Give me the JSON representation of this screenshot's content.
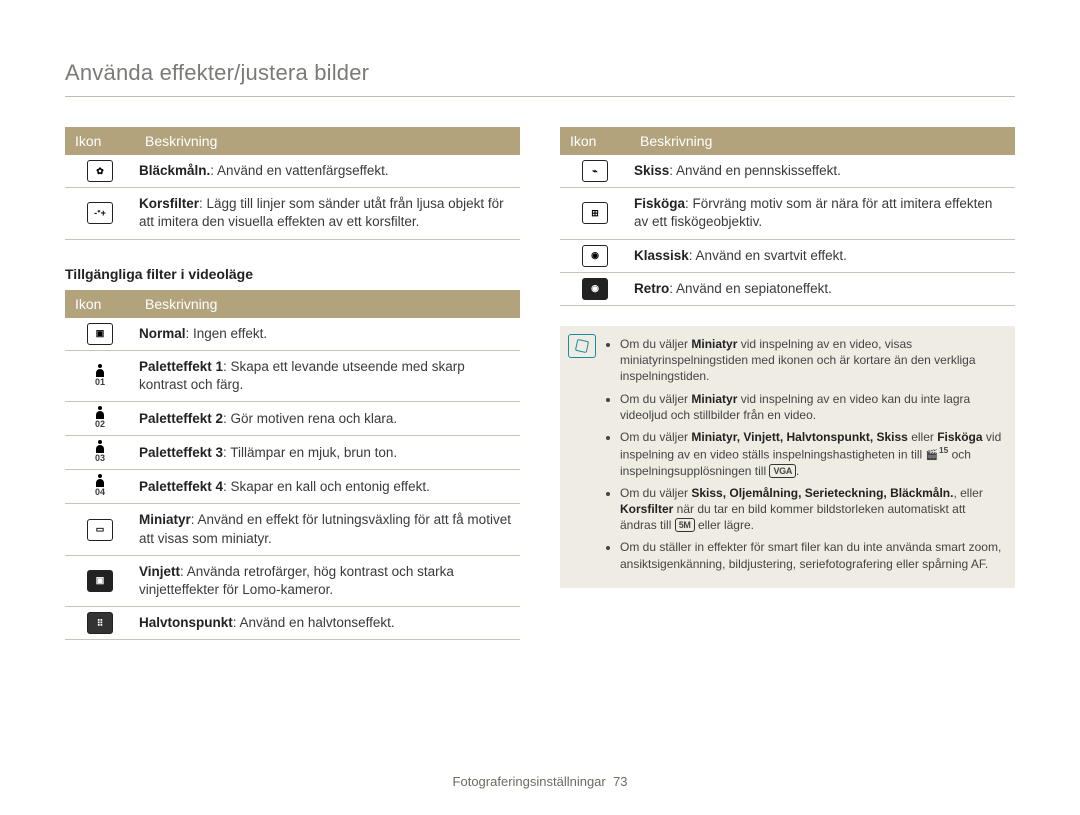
{
  "page_title": "Använda effekter/justera bilder",
  "headers": {
    "ikon": "Ikon",
    "beskrivning": "Beskrivning"
  },
  "section_subtitle": "Tillgängliga filter i videoläge",
  "table1": [
    {
      "icon": "paint",
      "label": "Bläckmåln.",
      "text": ": Använd en vattenfärgseffekt."
    },
    {
      "icon": "cross",
      "label": "Korsfilter",
      "text": ": Lägg till linjer som sänder utåt från ljusa objekt för att imitera den visuella effekten av ett korsfilter."
    }
  ],
  "table2": [
    {
      "icon": "normal",
      "label": "Normal",
      "text": ": Ingen effekt."
    },
    {
      "icon": "p1",
      "sub": "01",
      "label": "Paletteffekt 1",
      "text": ": Skapa ett levande utseende med skarp kontrast och färg."
    },
    {
      "icon": "p2",
      "sub": "02",
      "label": "Paletteffekt 2",
      "text": ": Gör motiven rena och klara."
    },
    {
      "icon": "p3",
      "sub": "03",
      "label": "Paletteffekt 3",
      "text": ": Tillämpar en mjuk, brun ton."
    },
    {
      "icon": "p4",
      "sub": "04",
      "label": "Paletteffekt 4",
      "text": ": Skapar en kall och entonig effekt."
    },
    {
      "icon": "mini",
      "label": "Miniatyr",
      "text": ": Använd en effekt för lutningsväxling för att få motivet att visas som miniatyr."
    },
    {
      "icon": "vign",
      "label": "Vinjett",
      "text": ": Använda retrofärger, hög kontrast och starka vinjetteffekter för Lomo-kameror."
    },
    {
      "icon": "half",
      "label": "Halvtonspunkt",
      "text": ": Använd en halvtonseffekt."
    }
  ],
  "table3": [
    {
      "icon": "sketch",
      "label": "Skiss",
      "text": ": Använd en pennskisseffekt."
    },
    {
      "icon": "fish",
      "label": "Fisköga",
      "text": ": Förvräng motiv som är nära för att imitera effekten av ett fiskögeobjektiv."
    },
    {
      "icon": "classic",
      "label": "Klassisk",
      "text": ": Använd en svartvit effekt."
    },
    {
      "icon": "retro",
      "label": "Retro",
      "text": ": Använd en sepiatoneffekt."
    }
  ],
  "notes": {
    "items": [
      {
        "pre": "Om du väljer ",
        "b1": "Miniatyr",
        "post": " vid inspelning av en video, visas miniatyrinspelningstiden med ikonen och är kortare än den verkliga inspelningstiden."
      },
      {
        "pre": "Om du väljer ",
        "b1": "Miniatyr",
        "post": " vid inspelning av en video kan du inte lagra videoljud och stillbilder från en video."
      },
      {
        "pre": "Om du väljer ",
        "b_list": "Miniatyr, Vinjett, Halvtonspunkt, Skiss",
        "mid": " eller ",
        "b_last": "Fisköga",
        "post1": " vid inspelning av en video ställs inspelningshastigheten in till ",
        "fps": "15",
        "post2": " och inspelningsupplösningen till ",
        "badge": "VGA",
        "post3": "."
      },
      {
        "pre": "Om du väljer ",
        "b_list2": "Skiss, Oljemålning, Serieteckning, Bläckmåln.",
        "mid2": ", eller ",
        "b_last2": "Korsfilter",
        "post4": " när du tar en bild kommer bildstorleken automatiskt att ändras till ",
        "badge2": "5M",
        "post5": " eller lägre."
      },
      {
        "plain": "Om du ställer in effekter för smart filer kan du inte använda smart zoom, ansiktsigenkänning, bildjustering, seriefotografering eller spårning AF."
      }
    ]
  },
  "footer": {
    "section": "Fotograferingsinställningar",
    "page": "73"
  }
}
